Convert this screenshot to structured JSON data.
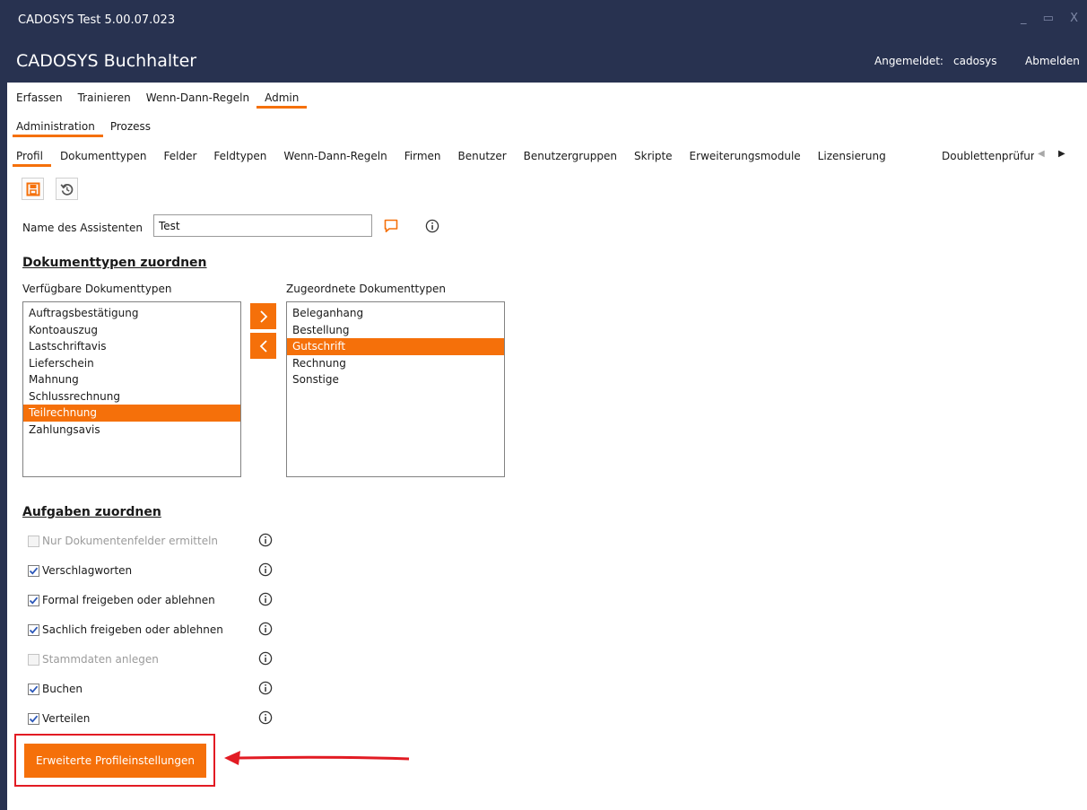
{
  "window": {
    "title": "CADOSYS Test 5.00.07.023",
    "controls": [
      "_",
      "▭",
      "X"
    ]
  },
  "app": {
    "title": "CADOSYS  Buchhalter",
    "logged_in_label": "Angemeldet:",
    "username": "cadosys",
    "logout": "Abmelden"
  },
  "nav_main": [
    {
      "label": "Erfassen",
      "active": false
    },
    {
      "label": "Trainieren",
      "active": false
    },
    {
      "label": "Wenn-Dann-Regeln",
      "active": false
    },
    {
      "label": "Admin",
      "active": true
    }
  ],
  "nav_admin": [
    {
      "label": "Administration",
      "active": true
    },
    {
      "label": "Prozess",
      "active": false
    }
  ],
  "nav_sub": [
    {
      "label": "Profil",
      "active": true
    },
    {
      "label": "Dokumenttypen",
      "active": false
    },
    {
      "label": "Felder",
      "active": false
    },
    {
      "label": "Feldtypen",
      "active": false
    },
    {
      "label": "Wenn-Dann-Regeln",
      "active": false
    },
    {
      "label": "Firmen",
      "active": false
    },
    {
      "label": "Benutzer",
      "active": false
    },
    {
      "label": "Benutzergruppen",
      "active": false
    },
    {
      "label": "Skripte",
      "active": false
    },
    {
      "label": "Erweiterungsmodule",
      "active": false
    },
    {
      "label": "Lizensierung",
      "active": false
    }
  ],
  "nav_sub_clipped": "Doublettenprüfung",
  "form": {
    "assistant_label": "Name des Assistenten",
    "assistant_value": "Test"
  },
  "doctypes": {
    "title": "Dokumenttypen zuordnen",
    "available_label": "Verfügbare Dokumenttypen",
    "assigned_label": "Zugeordnete Dokumenttypen",
    "available": [
      {
        "label": "Auftragsbestätigung",
        "selected": false
      },
      {
        "label": "Kontoauszug",
        "selected": false
      },
      {
        "label": "Lastschriftavis",
        "selected": false
      },
      {
        "label": "Lieferschein",
        "selected": false
      },
      {
        "label": "Mahnung",
        "selected": false
      },
      {
        "label": "Schlussrechnung",
        "selected": false
      },
      {
        "label": "Teilrechnung",
        "selected": true
      },
      {
        "label": "Zahlungsavis",
        "selected": false
      }
    ],
    "assigned": [
      {
        "label": "Beleganhang",
        "selected": false
      },
      {
        "label": "Bestellung",
        "selected": false
      },
      {
        "label": "Gutschrift",
        "selected": true
      },
      {
        "label": "Rechnung",
        "selected": false
      },
      {
        "label": "Sonstige",
        "selected": false
      }
    ]
  },
  "tasks": {
    "title": "Aufgaben zuordnen",
    "items": [
      {
        "label": "Nur Dokumentenfelder ermitteln",
        "checked": false,
        "disabled": true
      },
      {
        "label": "Verschlagworten",
        "checked": true,
        "disabled": false
      },
      {
        "label": "Formal freigeben oder ablehnen",
        "checked": true,
        "disabled": false
      },
      {
        "label": "Sachlich freigeben oder ablehnen",
        "checked": true,
        "disabled": false
      },
      {
        "label": "Stammdaten anlegen",
        "checked": false,
        "disabled": true
      },
      {
        "label": "Buchen",
        "checked": true,
        "disabled": false
      },
      {
        "label": "Verteilen",
        "checked": true,
        "disabled": false
      }
    ]
  },
  "advanced_button": "Erweiterte Profileinstellungen",
  "colors": {
    "accent": "#f5700a",
    "header": "#283250",
    "highlight": "#e21b23"
  }
}
